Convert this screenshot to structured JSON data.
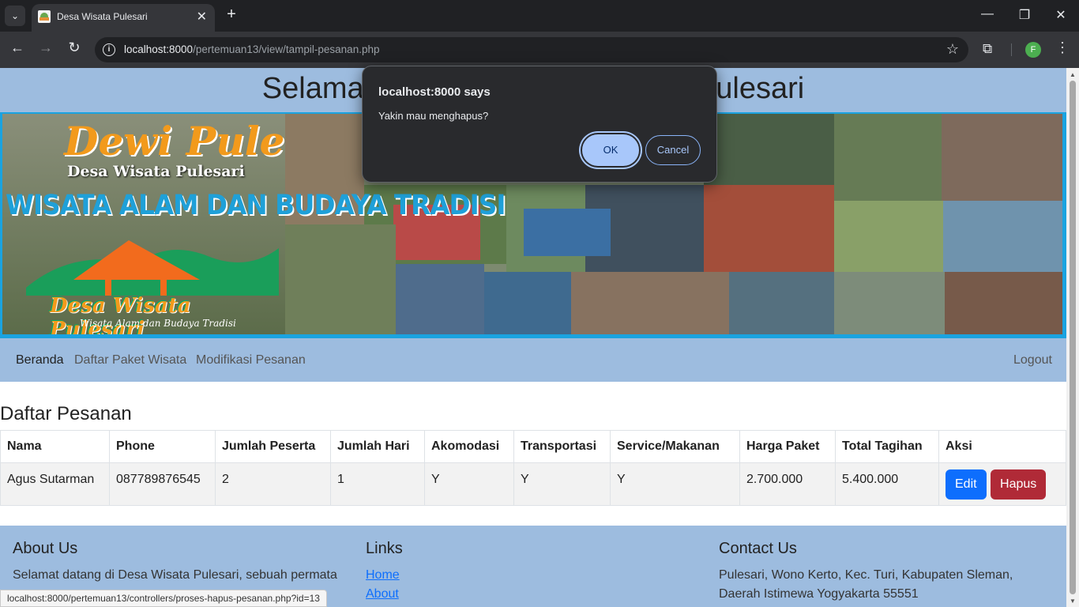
{
  "browser": {
    "tab_title": "Desa Wisata Pulesari",
    "url_host": "localhost:8000",
    "url_path": "/pertemuan13/view/tampil-pesanan.php",
    "profile_initial": "F"
  },
  "page": {
    "title": "Selamat Datang di Desa Wisata Pulesari",
    "banner": {
      "brand": "Dewi Pule",
      "desa": "Desa Wisata Pulesari",
      "headline": "WISATA ALAM DAN BUDAYA TRADISI",
      "desa_bottom": "Desa Wisata Pulesari",
      "tagline": "Wisata Alam dan Budaya Tradisi"
    },
    "nav": {
      "items": [
        "Beranda",
        "Daftar Paket Wisata",
        "Modifikasi Pesanan"
      ],
      "logout": "Logout"
    },
    "section_title": "Daftar Pesanan",
    "table": {
      "headers": [
        "Nama",
        "Phone",
        "Jumlah Peserta",
        "Jumlah Hari",
        "Akomodasi",
        "Transportasi",
        "Service/Makanan",
        "Harga Paket",
        "Total Tagihan",
        "Aksi"
      ],
      "rows": [
        {
          "nama": "Agus Sutarman",
          "phone": "087789876545",
          "jumlah_peserta": "2",
          "jumlah_hari": "1",
          "akomodasi": "Y",
          "transportasi": "Y",
          "service": "Y",
          "harga_paket": "2.700.000",
          "total_tagihan": "5.400.000",
          "edit_label": "Edit",
          "hapus_label": "Hapus"
        }
      ]
    },
    "footer": {
      "about_title": "About Us",
      "about_text": "Selamat datang di Desa Wisata Pulesari, sebuah permata",
      "links_title": "Links",
      "links": [
        "Home",
        "About"
      ],
      "contact_title": "Contact Us",
      "contact_text": "Pulesari, Wono Kerto, Kec. Turi, Kabupaten Sleman, Daerah Istimewa Yogyakarta 55551"
    },
    "status_url": "localhost:8000/pertemuan13/controllers/proses-hapus-pesanan.php?id=13"
  },
  "dialog": {
    "title": "localhost:8000 says",
    "message": "Yakin mau menghapus?",
    "ok_label": "OK",
    "cancel_label": "Cancel"
  },
  "colors": {
    "header_bg": "#9dbcdf",
    "edit_btn": "#0d6efd",
    "hapus_btn": "#b02a37",
    "dialog_bg": "#292a2d",
    "dialog_ok": "#a8c7fa"
  }
}
